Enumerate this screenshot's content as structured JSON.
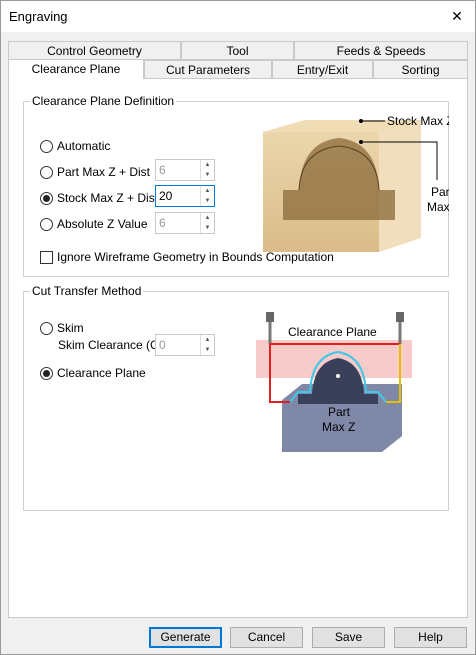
{
  "window": {
    "title": "Engraving",
    "close_glyph": "✕"
  },
  "tabs_row1": [
    "Control Geometry",
    "Tool",
    "Feeds & Speeds"
  ],
  "tabs_row2": [
    "Clearance Plane",
    "Cut Parameters",
    "Entry/Exit",
    "Sorting"
  ],
  "clearance_def": {
    "legend": "Clearance Plane Definition",
    "options": [
      {
        "label": "Automatic",
        "selected": false
      },
      {
        "label": "Part Max Z + Dist",
        "selected": false,
        "value": "6"
      },
      {
        "label": "Stock Max Z + Dist",
        "selected": true,
        "value": "20"
      },
      {
        "label": "Absolute Z Value",
        "selected": false,
        "value": "6"
      }
    ],
    "ignore_wireframe": {
      "label": "Ignore Wireframe Geometry in Bounds Computation",
      "checked": false
    },
    "image": {
      "label_stock": "Stock Max Z",
      "label_part_1": "Part",
      "label_part_2": "Max Z"
    }
  },
  "cut_transfer": {
    "legend": "Cut Transfer Method",
    "skim": {
      "label": "Skim",
      "selected": false
    },
    "skim_clearance": {
      "label": "Skim Clearance (C)",
      "value": "0"
    },
    "clearance_plane": {
      "label": "Clearance Plane",
      "selected": true
    },
    "image": {
      "label_plane": "Clearance Plane",
      "label_part_1": "Part",
      "label_part_2": "Max Z"
    }
  },
  "buttons": {
    "generate": "Generate",
    "cancel": "Cancel",
    "save": "Save",
    "help": "Help"
  },
  "colors": {
    "accent": "#0078d7",
    "clearance_line": "#e02020",
    "part_outline": "#40c8e8",
    "plane_fill": "#f3a8a8"
  }
}
